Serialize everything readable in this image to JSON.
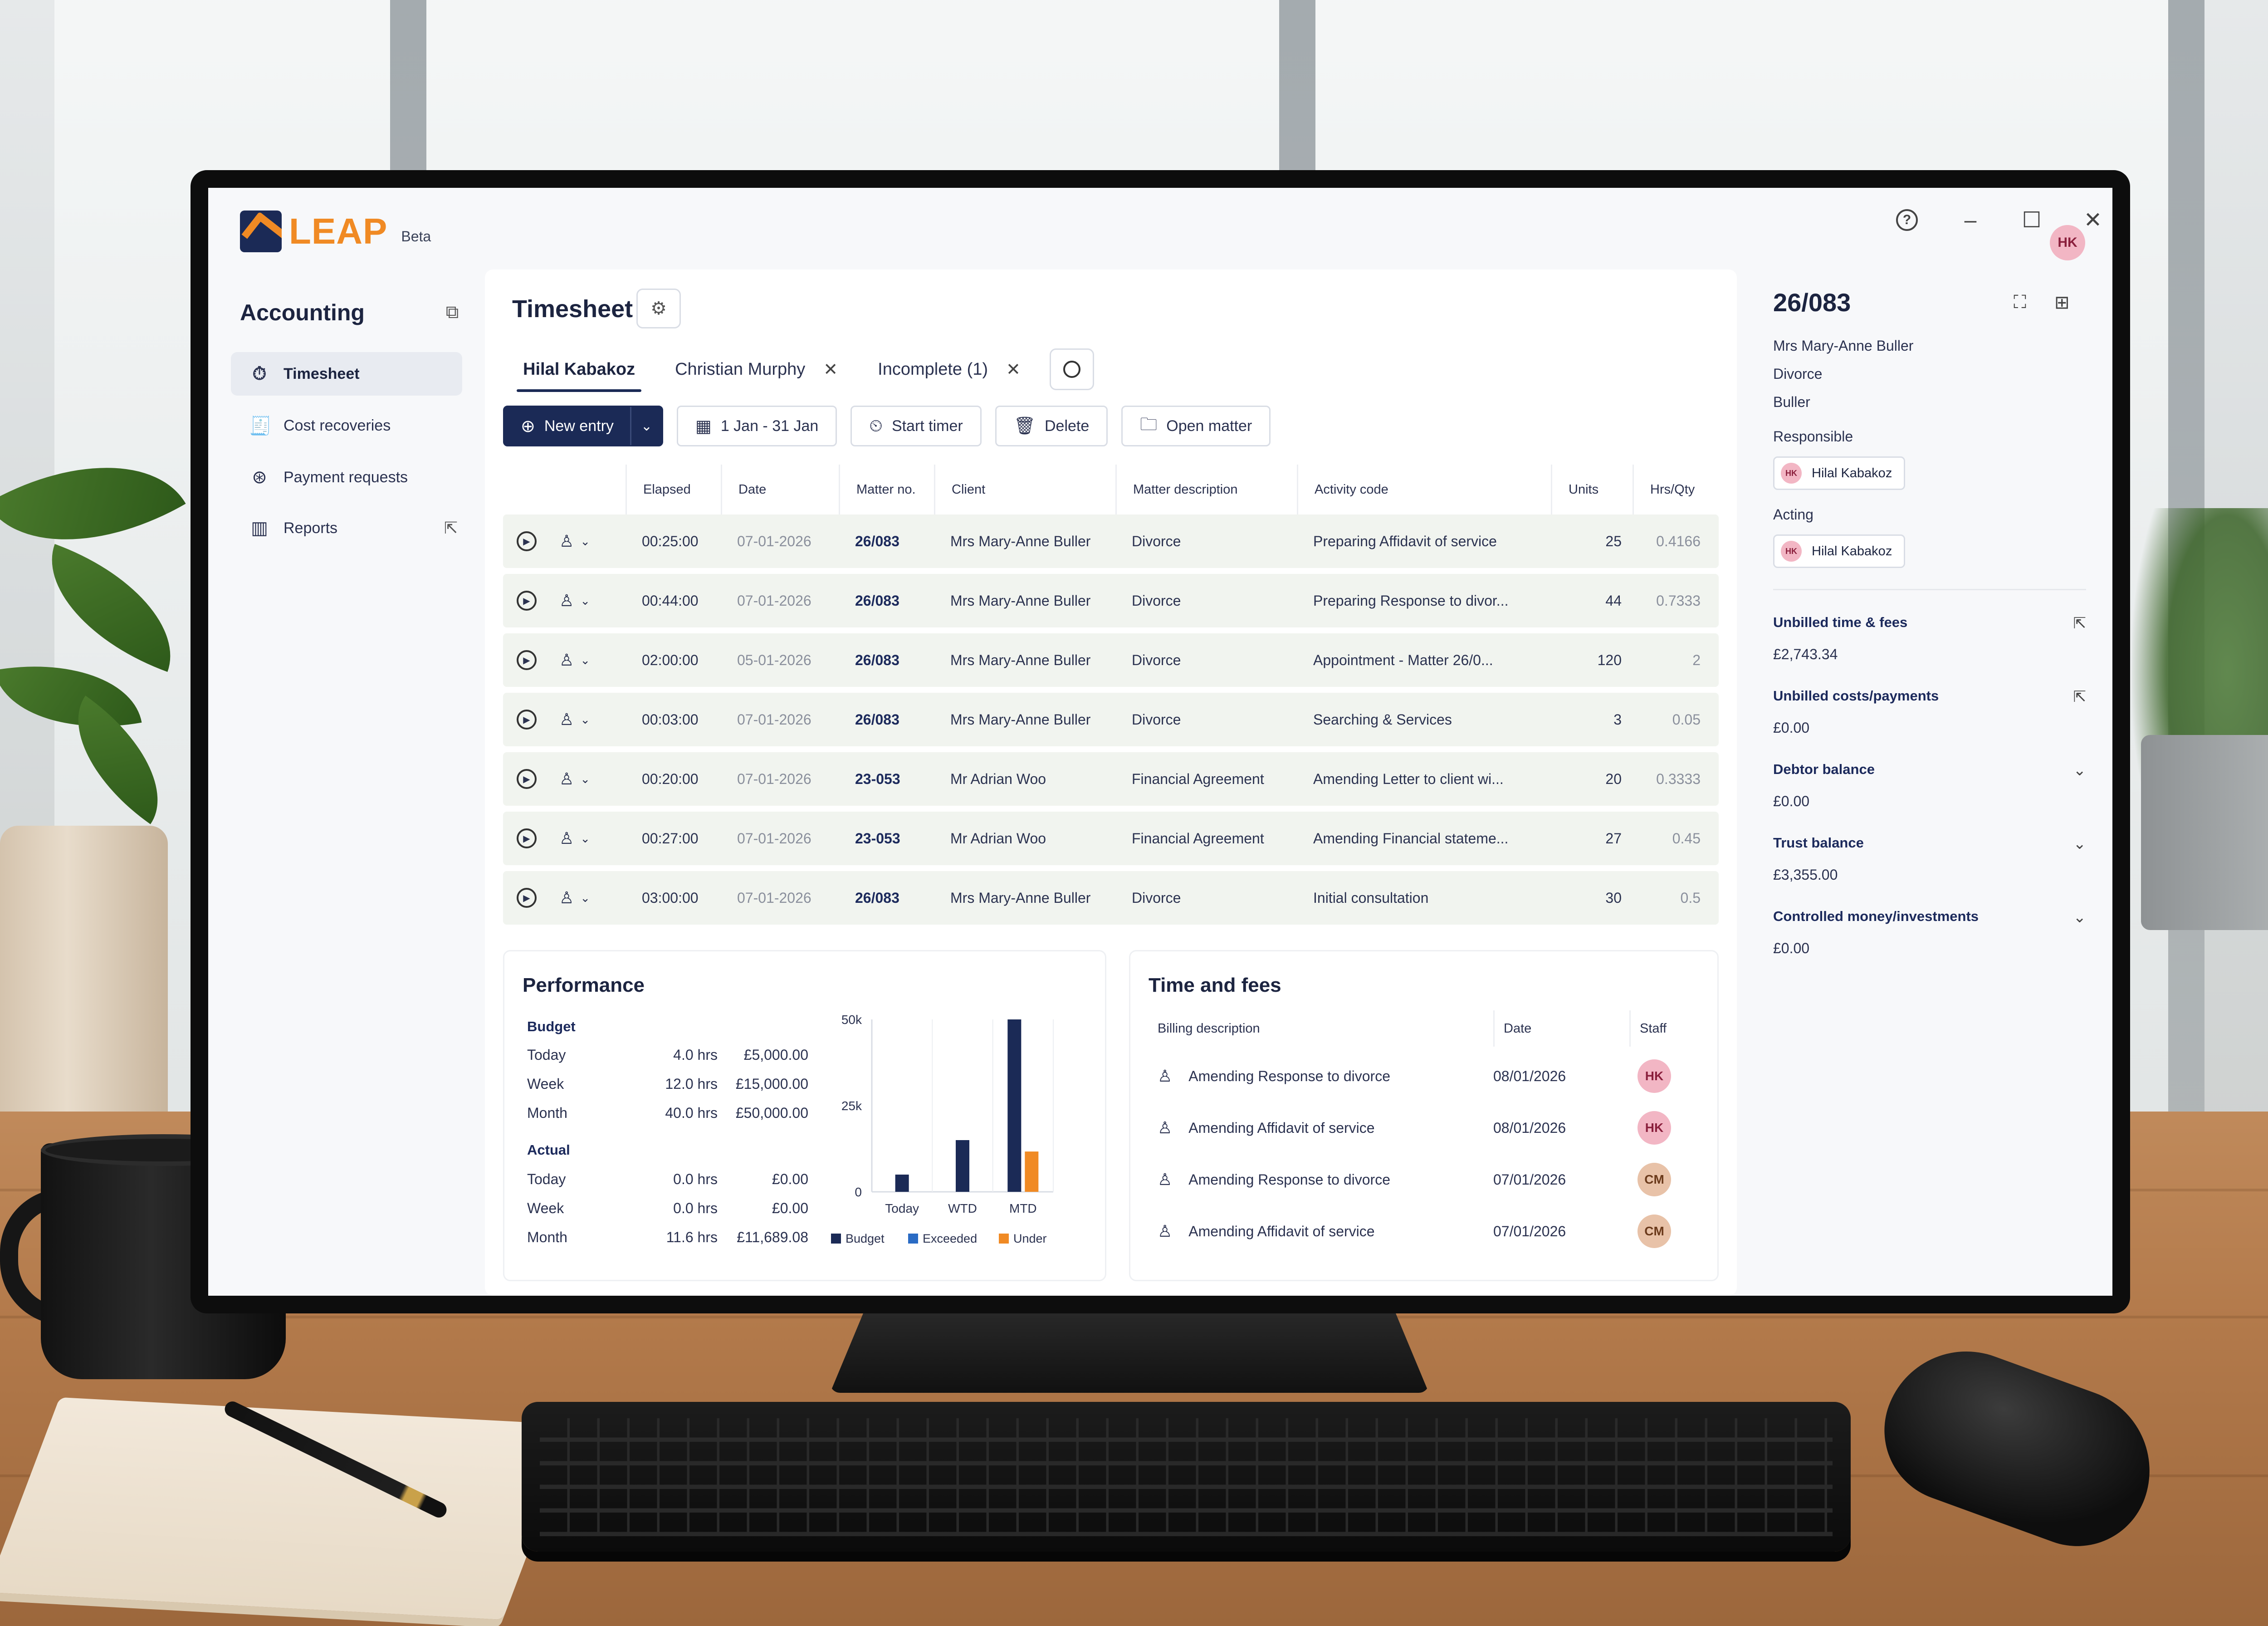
{
  "app": {
    "brand": "LEAP",
    "badge": "Beta",
    "user_initials": "HK"
  },
  "window_controls": {
    "help": "?",
    "minimize": "–",
    "maximize": "☐",
    "close": "✕"
  },
  "sidebar": {
    "title": "Accounting",
    "items": [
      {
        "label": "Timesheet",
        "icon": "stopwatch-icon",
        "active": true
      },
      {
        "label": "Cost recoveries",
        "icon": "receipt-icon"
      },
      {
        "label": "Payment requests",
        "icon": "payment-icon"
      },
      {
        "label": "Reports",
        "icon": "bar-chart-icon"
      }
    ]
  },
  "main": {
    "title": "Timesheet",
    "tabs": [
      {
        "label": "Hilal Kabakoz",
        "active": true
      },
      {
        "label": "Christian Murphy"
      },
      {
        "label": "Incomplete (1)"
      }
    ],
    "toolbar": {
      "new_entry": "New entry",
      "date_range": "1 Jan - 31 Jan",
      "start_timer": "Start timer",
      "delete": "Delete",
      "open_matter": "Open matter"
    },
    "table": {
      "columns": [
        "Elapsed",
        "Date",
        "Matter no.",
        "Client",
        "Matter description",
        "Activity code",
        "Units",
        "Hrs/Qty"
      ],
      "rows": [
        {
          "elapsed": "00:25:00",
          "date": "07-01-2026",
          "matter": "26/083",
          "client": "Mrs Mary-Anne Buller",
          "description": "Divorce",
          "activity": "Preparing Affidavit of service",
          "units": "25",
          "hrs": "0.4166"
        },
        {
          "elapsed": "00:44:00",
          "date": "07-01-2026",
          "matter": "26/083",
          "client": "Mrs Mary-Anne Buller",
          "description": "Divorce",
          "activity": "Preparing Response to divor...",
          "units": "44",
          "hrs": "0.7333"
        },
        {
          "elapsed": "02:00:00",
          "date": "05-01-2026",
          "matter": "26/083",
          "client": "Mrs Mary-Anne Buller",
          "description": "Divorce",
          "activity": "Appointment - Matter 26/0...",
          "units": "120",
          "hrs": "2"
        },
        {
          "elapsed": "00:03:00",
          "date": "07-01-2026",
          "matter": "26/083",
          "client": "Mrs Mary-Anne Buller",
          "description": "Divorce",
          "activity": "Searching & Services",
          "units": "3",
          "hrs": "0.05"
        },
        {
          "elapsed": "00:20:00",
          "date": "07-01-2026",
          "matter": "23-053",
          "client": "Mr Adrian Woo",
          "description": "Financial Agreement",
          "activity": "Amending Letter to client wi...",
          "units": "20",
          "hrs": "0.3333"
        },
        {
          "elapsed": "00:27:00",
          "date": "07-01-2026",
          "matter": "23-053",
          "client": "Mr Adrian Woo",
          "description": "Financial Agreement",
          "activity": "Amending Financial stateme...",
          "units": "27",
          "hrs": "0.45"
        },
        {
          "elapsed": "03:00:00",
          "date": "07-01-2026",
          "matter": "26/083",
          "client": "Mrs Mary-Anne Buller",
          "description": "Divorce",
          "activity": "Initial consultation",
          "units": "30",
          "hrs": "0.5"
        }
      ]
    }
  },
  "performance": {
    "title": "Performance",
    "budget_label": "Budget",
    "actual_label": "Actual",
    "budget": [
      {
        "period": "Today",
        "hours": "4.0 hrs",
        "amount": "£5,000.00"
      },
      {
        "period": "Week",
        "hours": "12.0 hrs",
        "amount": "£15,000.00"
      },
      {
        "period": "Month",
        "hours": "40.0 hrs",
        "amount": "£50,000.00"
      }
    ],
    "actual": [
      {
        "period": "Today",
        "hours": "0.0 hrs",
        "amount": "£0.00"
      },
      {
        "period": "Week",
        "hours": "0.0 hrs",
        "amount": "£0.00"
      },
      {
        "period": "Month",
        "hours": "11.6 hrs",
        "amount": "£11,689.08"
      }
    ]
  },
  "chart_data": {
    "type": "bar",
    "categories": [
      "Today",
      "WTD",
      "MTD"
    ],
    "series": [
      {
        "name": "Budget",
        "color": "#1b2a56",
        "values": [
          5000,
          15000,
          50000
        ]
      },
      {
        "name": "Exceeded",
        "color": "#2a6bc4",
        "values": [
          0,
          0,
          0
        ]
      },
      {
        "name": "Under",
        "color": "#f08a24",
        "values": [
          0,
          0,
          11689.08
        ]
      }
    ],
    "ylim": [
      0,
      50000
    ],
    "yticks": [
      "0",
      "25k",
      "50k"
    ],
    "legend": "bottom",
    "grid": true
  },
  "time_and_fees": {
    "title": "Time and fees",
    "columns": [
      "Billing description",
      "Date",
      "Staff"
    ],
    "rows": [
      {
        "description": "Amending Response to divorce",
        "date": "08/01/2026",
        "staff": "HK"
      },
      {
        "description": "Amending Affidavit of service",
        "date": "08/01/2026",
        "staff": "HK"
      },
      {
        "description": "Amending Response to divorce",
        "date": "07/01/2026",
        "staff": "CM"
      },
      {
        "description": "Amending Affidavit of service",
        "date": "07/01/2026",
        "staff": "CM"
      }
    ]
  },
  "matter_panel": {
    "number": "26/083",
    "client": "Mrs Mary-Anne Buller",
    "type": "Divorce",
    "short_name": "Buller",
    "responsible_label": "Responsible",
    "responsible": {
      "initials": "HK",
      "name": "Hilal Kabakoz"
    },
    "acting_label": "Acting",
    "acting": {
      "initials": "HK",
      "name": "Hilal Kabakoz"
    },
    "sections": [
      {
        "label": "Unbilled time & fees",
        "value": "£2,743.34",
        "icon": "external-link-icon"
      },
      {
        "label": "Unbilled costs/payments",
        "value": "£0.00",
        "icon": "external-link-icon"
      },
      {
        "label": "Debtor balance",
        "value": "£0.00",
        "icon": "chevron-down-icon"
      },
      {
        "label": "Trust balance",
        "value": "£3,355.00",
        "icon": "chevron-down-icon"
      },
      {
        "label": "Controlled money/investments",
        "value": "£0.00",
        "icon": "chevron-down-icon"
      }
    ]
  }
}
